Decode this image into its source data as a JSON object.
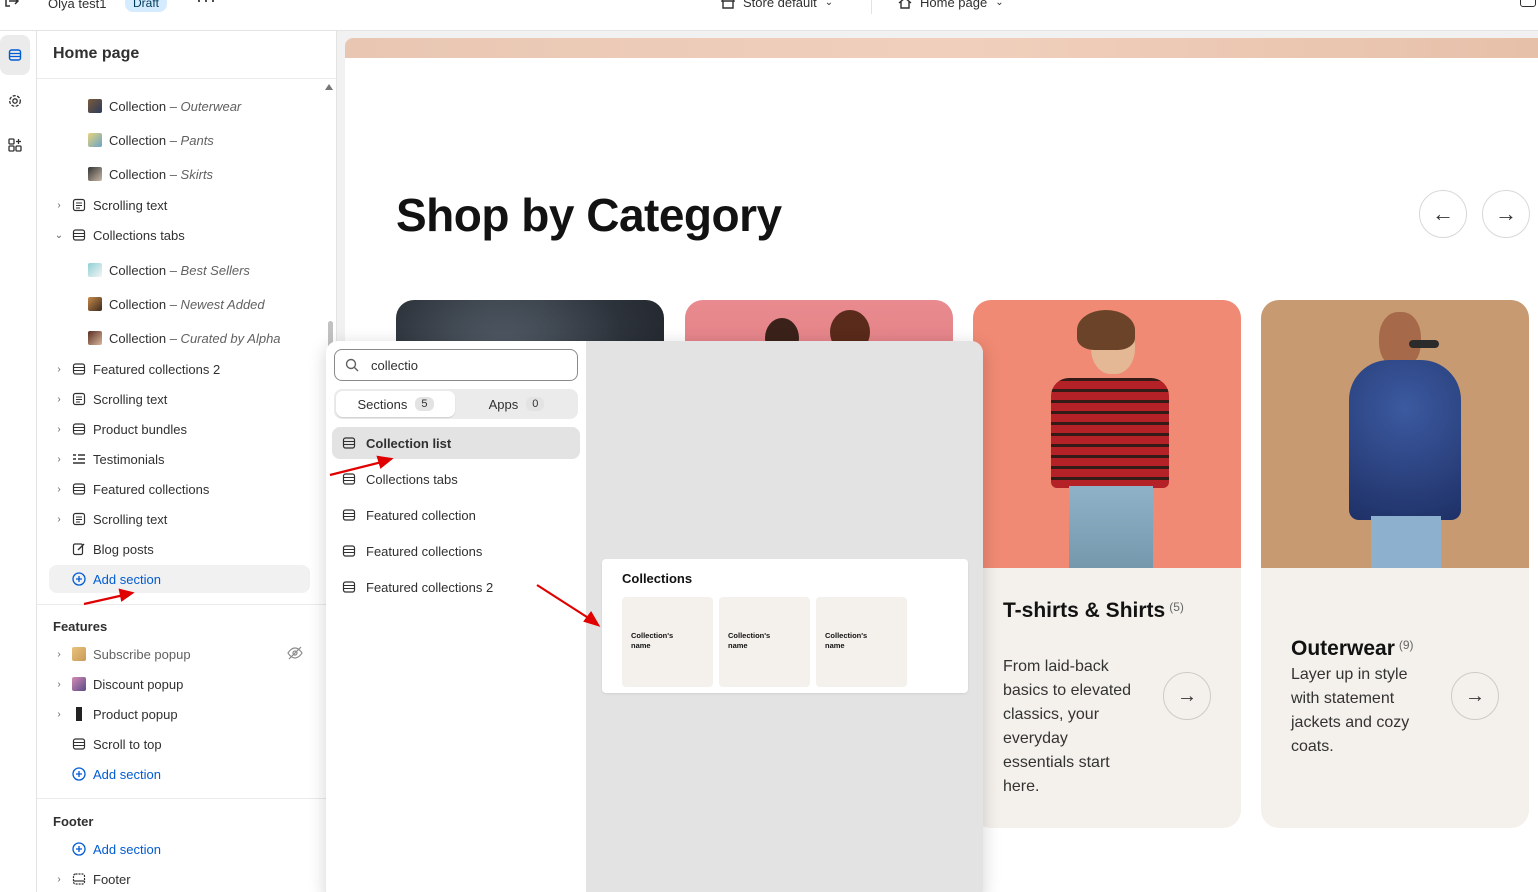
{
  "topbar": {
    "theme_name": "Olya test1",
    "status_badge": "Draft",
    "more": "···",
    "store_context": "Store default",
    "page_context": "Home page"
  },
  "sidebar": {
    "title": "Home page",
    "items": [
      {
        "label": "Collection",
        "sub": "– Outerwear"
      },
      {
        "label": "Collection",
        "sub": "– Pants"
      },
      {
        "label": "Collection",
        "sub": "– Skirts"
      },
      {
        "label": "Scrolling text"
      },
      {
        "label": "Collections tabs"
      },
      {
        "label": "Collection",
        "sub": "– Best Sellers"
      },
      {
        "label": "Collection",
        "sub": "– Newest Added"
      },
      {
        "label": "Collection",
        "sub": "– Curated by Alpha"
      },
      {
        "label": "Featured collections 2"
      },
      {
        "label": "Scrolling text"
      },
      {
        "label": "Product bundles"
      },
      {
        "label": "Testimonials"
      },
      {
        "label": "Featured collections"
      },
      {
        "label": "Scrolling text"
      },
      {
        "label": "Blog posts"
      }
    ],
    "add_section": "Add section",
    "features_title": "Features",
    "features": [
      {
        "label": "Subscribe popup"
      },
      {
        "label": "Discount popup"
      },
      {
        "label": "Product popup"
      },
      {
        "label": "Scroll to top"
      }
    ],
    "footer_title": "Footer",
    "footer_item": "Footer"
  },
  "popup": {
    "search_value": "collectio",
    "tabs": [
      {
        "label": "Sections",
        "count": "5"
      },
      {
        "label": "Apps",
        "count": "0"
      }
    ],
    "results": [
      "Collection list",
      "Collections tabs",
      "Featured collection",
      "Featured collections",
      "Featured collections 2"
    ],
    "preview": {
      "title": "Collections",
      "tiles": [
        "Collection's name",
        "Collection's name",
        "Collection's name"
      ]
    }
  },
  "preview": {
    "heading": "Shop by Category",
    "cards": [
      {
        "title": "T-shirts & Shirts",
        "count": "(5)",
        "desc": "From laid-back basics to elevated classics, your everyday essentials start here."
      },
      {
        "title": "Outerwear",
        "count": "(9)",
        "desc": "Layer up in style with statement jackets and cozy coats."
      }
    ]
  },
  "colors": {
    "accent": "#005bd3",
    "card_bg": "#f4f1ec",
    "arrow": "#e00000"
  }
}
